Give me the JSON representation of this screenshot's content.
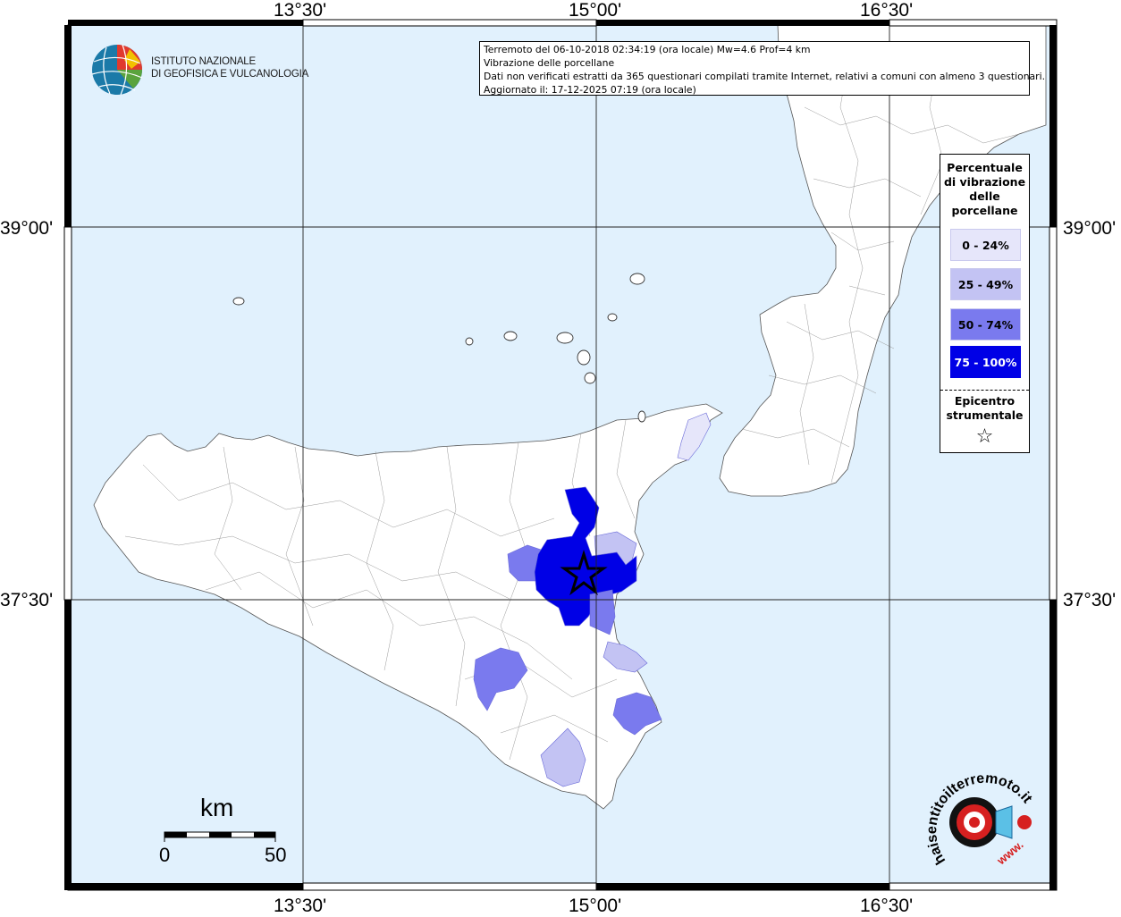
{
  "map": {
    "lon_labels": [
      "13°30'",
      "15°00'",
      "16°30'"
    ],
    "lat_labels": [
      "39°00'",
      "37°30'"
    ],
    "sea_color": "#e1f1fd",
    "land_color": "#ffffff"
  },
  "info": {
    "line1": "Terremoto del 06-10-2018 02:34:19 (ora locale) Mw=4.6 Prof=4 km",
    "line2": "Vibrazione delle porcellane",
    "line3": "Dati non verificati estratti da 365 questionari compilati tramite Internet, relativi a comuni con almeno 3 questionari.",
    "line4": "Aggiornato il: 17-12-2025 07:19 (ora locale)"
  },
  "ingv": {
    "line1": "ISTITUTO NAZIONALE",
    "line2": "DI GEOFISICA E VULCANOLOGIA"
  },
  "legend": {
    "title_lines": [
      "Percentuale",
      "di vibrazione",
      "delle",
      "porcellane"
    ],
    "classes": [
      {
        "label": "0 - 24%",
        "color": "#e6e6fa",
        "text_color": "#000000"
      },
      {
        "label": "25 - 49%",
        "color": "#c3c3f3",
        "text_color": "#000000"
      },
      {
        "label": "50 - 74%",
        "color": "#7a7aee",
        "text_color": "#000000"
      },
      {
        "label": "75 - 100%",
        "color": "#0000e6",
        "text_color": "#ffffff"
      }
    ],
    "epicenter_lines": [
      "Epicentro",
      "strumentale"
    ],
    "epicenter_symbol": "☆"
  },
  "scale": {
    "unit": "km",
    "min_label": "0",
    "max_label": "50"
  },
  "site_logo": {
    "text": "haisentitoilterremoto.it",
    "prefix": "www."
  }
}
